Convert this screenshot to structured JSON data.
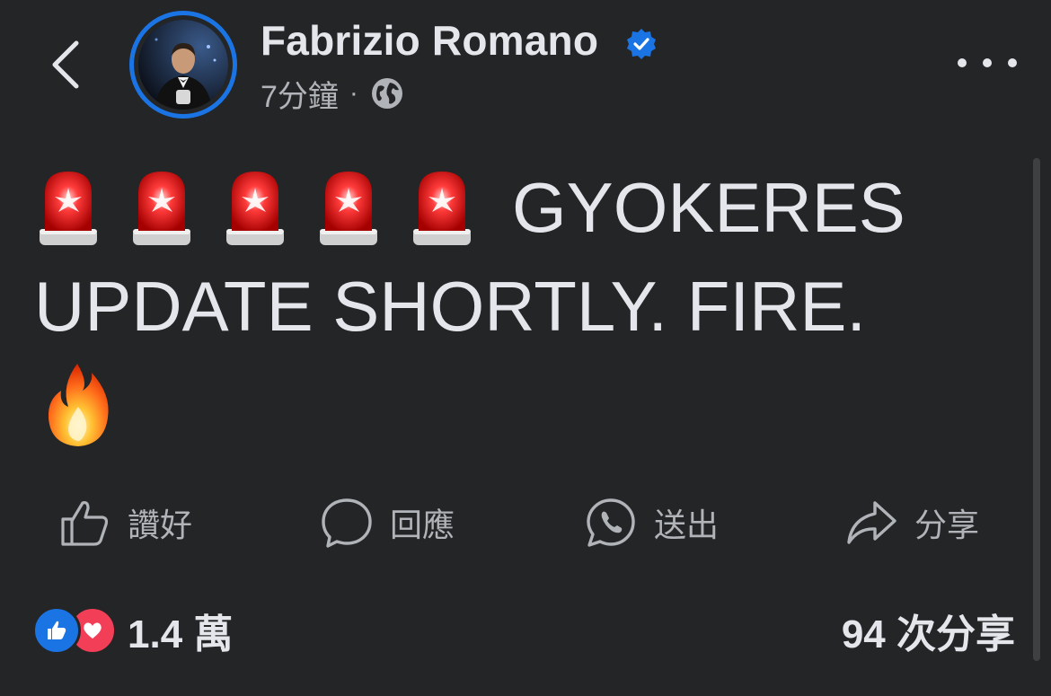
{
  "header": {
    "author_name": "Fabrizio Romano",
    "timestamp": "7分鐘",
    "separator": "·",
    "audience_icon": "globe-icon",
    "back_icon": "chevron-left-icon",
    "more_icon": "more-horizontal-icon",
    "verified_icon": "verified-badge-icon"
  },
  "post": {
    "line1_text": "GYOKERES",
    "line2_text": "UPDATE SHORTLY. FIRE.",
    "emoji_line1": "🚨🚨🚨🚨🚨",
    "emoji_line3": "🔥"
  },
  "actions": [
    {
      "label": "讚好",
      "icon": "thumbs-up-icon"
    },
    {
      "label": "回應",
      "icon": "comment-icon"
    },
    {
      "label": "送出",
      "icon": "whatsapp-icon"
    },
    {
      "label": "分享",
      "icon": "share-arrow-icon"
    }
  ],
  "footer": {
    "reaction_count": "1.4 萬",
    "share_count": "94 次分享"
  },
  "colors": {
    "background": "#242526",
    "text_primary": "#e4e6eb",
    "text_secondary": "#b0b3b8",
    "accent_blue": "#1b74e4",
    "love_red": "#f33e58"
  }
}
